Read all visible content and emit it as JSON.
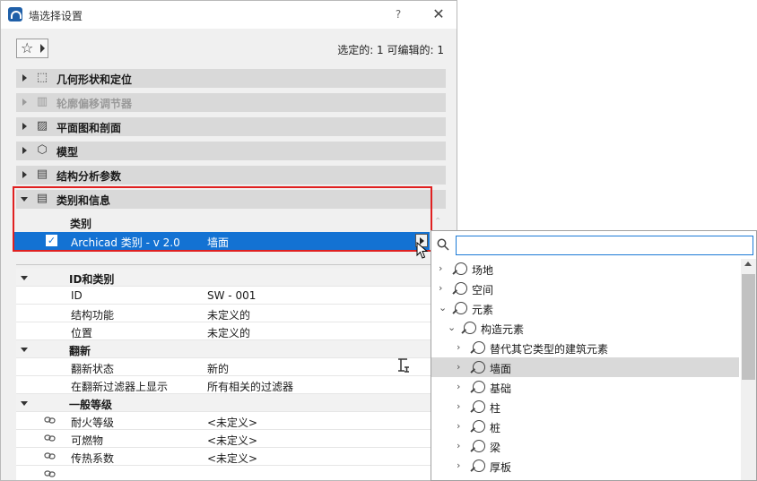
{
  "window": {
    "title": "墙选择设置",
    "help": "?",
    "close": "✕"
  },
  "selection_status": "选定的: 1 可编辑的: 1",
  "panels": [
    {
      "label": "几何形状和定位",
      "icon": "geometry-icon",
      "disabled": false
    },
    {
      "label": "轮廓偏移调节器",
      "icon": "profile-modifier-icon",
      "disabled": true
    },
    {
      "label": "平面图和剖面",
      "icon": "floorplan-section-icon",
      "disabled": false
    },
    {
      "label": "模型",
      "icon": "model-icon",
      "disabled": false
    },
    {
      "label": "结构分析参数",
      "icon": "structural-analysis-icon",
      "disabled": false
    },
    {
      "label": "类别和信息",
      "icon": "classification-icon",
      "disabled": false,
      "expanded": true
    }
  ],
  "classification": {
    "header": "类别",
    "row": {
      "checked": true,
      "name": "Archicad 类别 - v 2.0",
      "value": "墙面"
    }
  },
  "properties": [
    {
      "type": "group",
      "name": "ID和类别"
    },
    {
      "type": "prop",
      "name": "ID",
      "value": "SW - 001"
    },
    {
      "type": "prop",
      "name": "结构功能",
      "value": "未定义的"
    },
    {
      "type": "prop",
      "name": "位置",
      "value": "未定义的"
    },
    {
      "type": "group",
      "name": "翻新"
    },
    {
      "type": "prop",
      "name": "翻新状态",
      "value": "新的"
    },
    {
      "type": "prop",
      "name": "在翻新过滤器上显示",
      "value": "所有相关的过滤器"
    },
    {
      "type": "group",
      "name": "一般等级"
    },
    {
      "type": "prop",
      "name": "耐火等级",
      "value": "<未定义>",
      "linked": true
    },
    {
      "type": "prop",
      "name": "可燃物",
      "value": "<未定义>",
      "linked": true
    },
    {
      "type": "prop",
      "name": "传热系数",
      "value": "<未定义>",
      "linked": true
    },
    {
      "type": "prop",
      "name": "",
      "value": "",
      "linked": true
    }
  ],
  "tree": {
    "search_value": "",
    "items": [
      {
        "label": "场地",
        "level": 0,
        "chevron": "›"
      },
      {
        "label": "空间",
        "level": 0,
        "chevron": "›"
      },
      {
        "label": "元素",
        "level": 0,
        "chevron": "⌄"
      },
      {
        "label": "构造元素",
        "level": 1,
        "chevron": "⌄"
      },
      {
        "label": "替代其它类型的建筑元素",
        "level": 2,
        "chevron": "›"
      },
      {
        "label": "墙面",
        "level": 2,
        "chevron": "›",
        "selected": true
      },
      {
        "label": "基础",
        "level": 2,
        "chevron": "›"
      },
      {
        "label": "柱",
        "level": 2,
        "chevron": "›"
      },
      {
        "label": "桩",
        "level": 2,
        "chevron": "›"
      },
      {
        "label": "梁",
        "level": 2,
        "chevron": "›"
      },
      {
        "label": "厚板",
        "level": 2,
        "chevron": "›"
      }
    ]
  }
}
